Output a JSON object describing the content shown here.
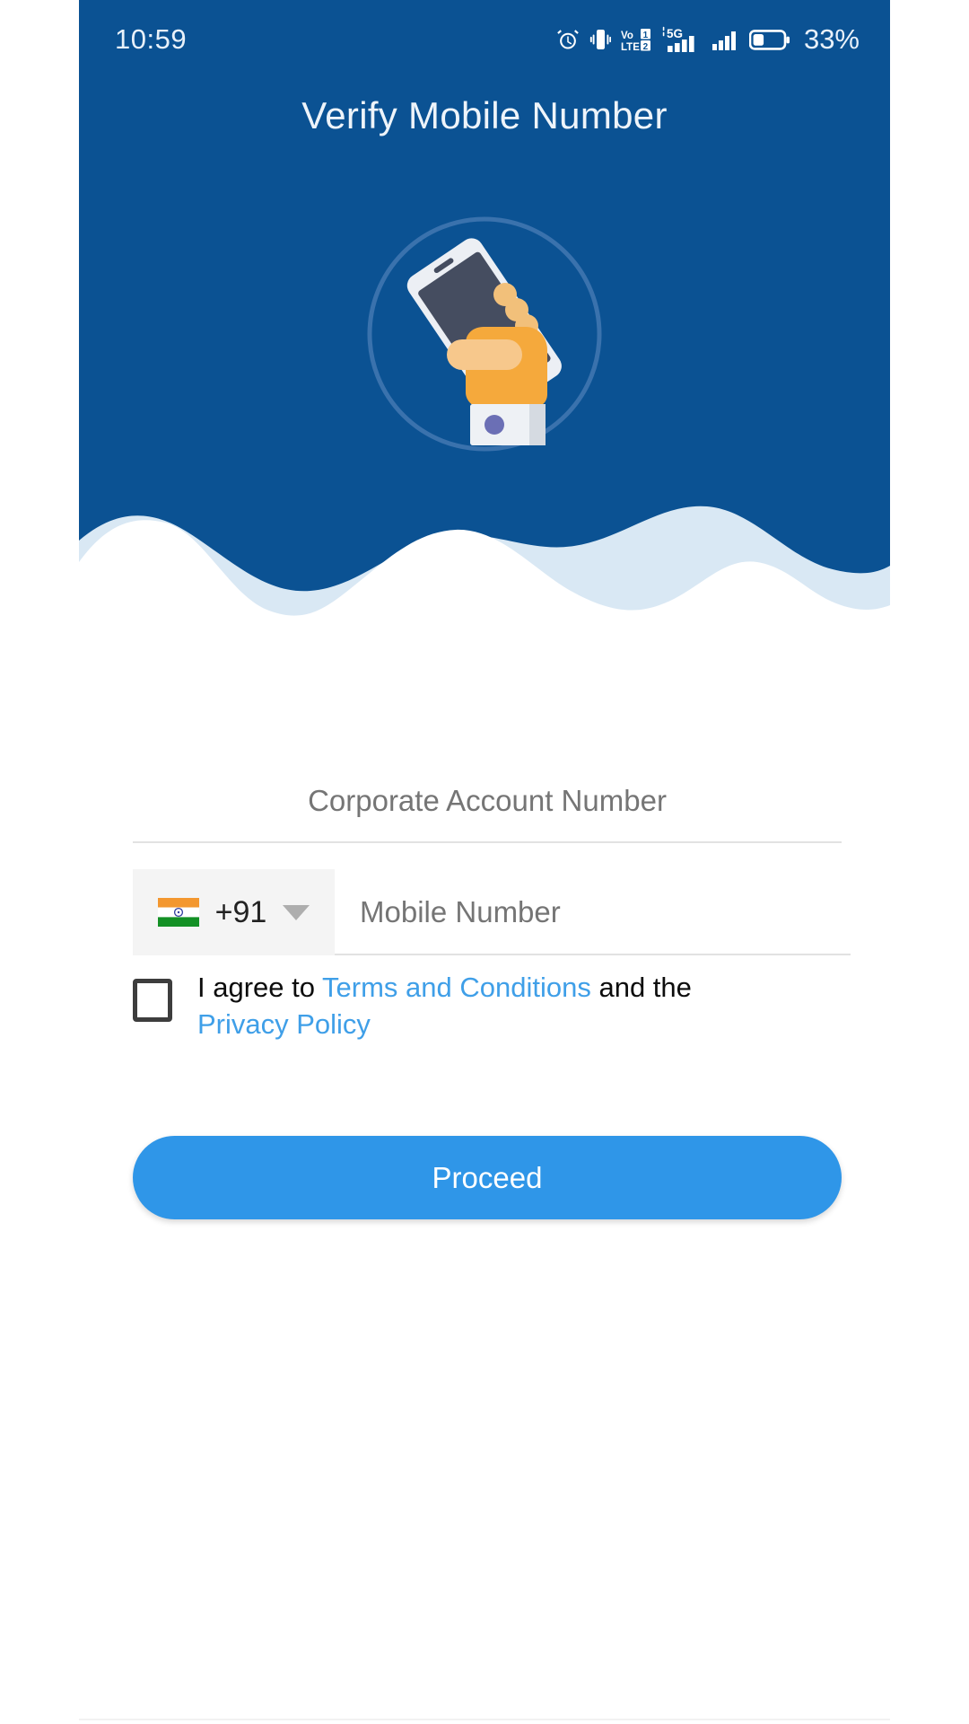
{
  "statusbar": {
    "time": "10:59",
    "battery_percent": "33%",
    "icons": [
      "alarm-icon",
      "vibrate-icon",
      "volte-dual-sim-icon",
      "signal-5g-icon",
      "signal-bars-icon",
      "battery-icon"
    ]
  },
  "header": {
    "title": "Verify Mobile Number",
    "illustration": "hand-holding-phone-illustration",
    "background_color": "#0b5293",
    "circle_outline_color": "#3a72ad",
    "wave_back_color": "#d9e8f4",
    "wave_front_color": "#ffffff"
  },
  "form": {
    "account": {
      "placeholder": "Corporate Account Number",
      "value": ""
    },
    "country": {
      "flag": "india-flag-icon",
      "dial_code": "+91",
      "caret": "chevron-down-icon"
    },
    "mobile": {
      "placeholder": "Mobile Number",
      "value": ""
    },
    "terms": {
      "checked": false,
      "prefix": "I agree to ",
      "terms_link": "Terms and Conditions",
      "middle": " and the ",
      "privacy_link": "Privacy Policy",
      "link_color": "#3f9fe8"
    },
    "submit": {
      "label": "Proceed",
      "color": "#2f96e8"
    }
  }
}
